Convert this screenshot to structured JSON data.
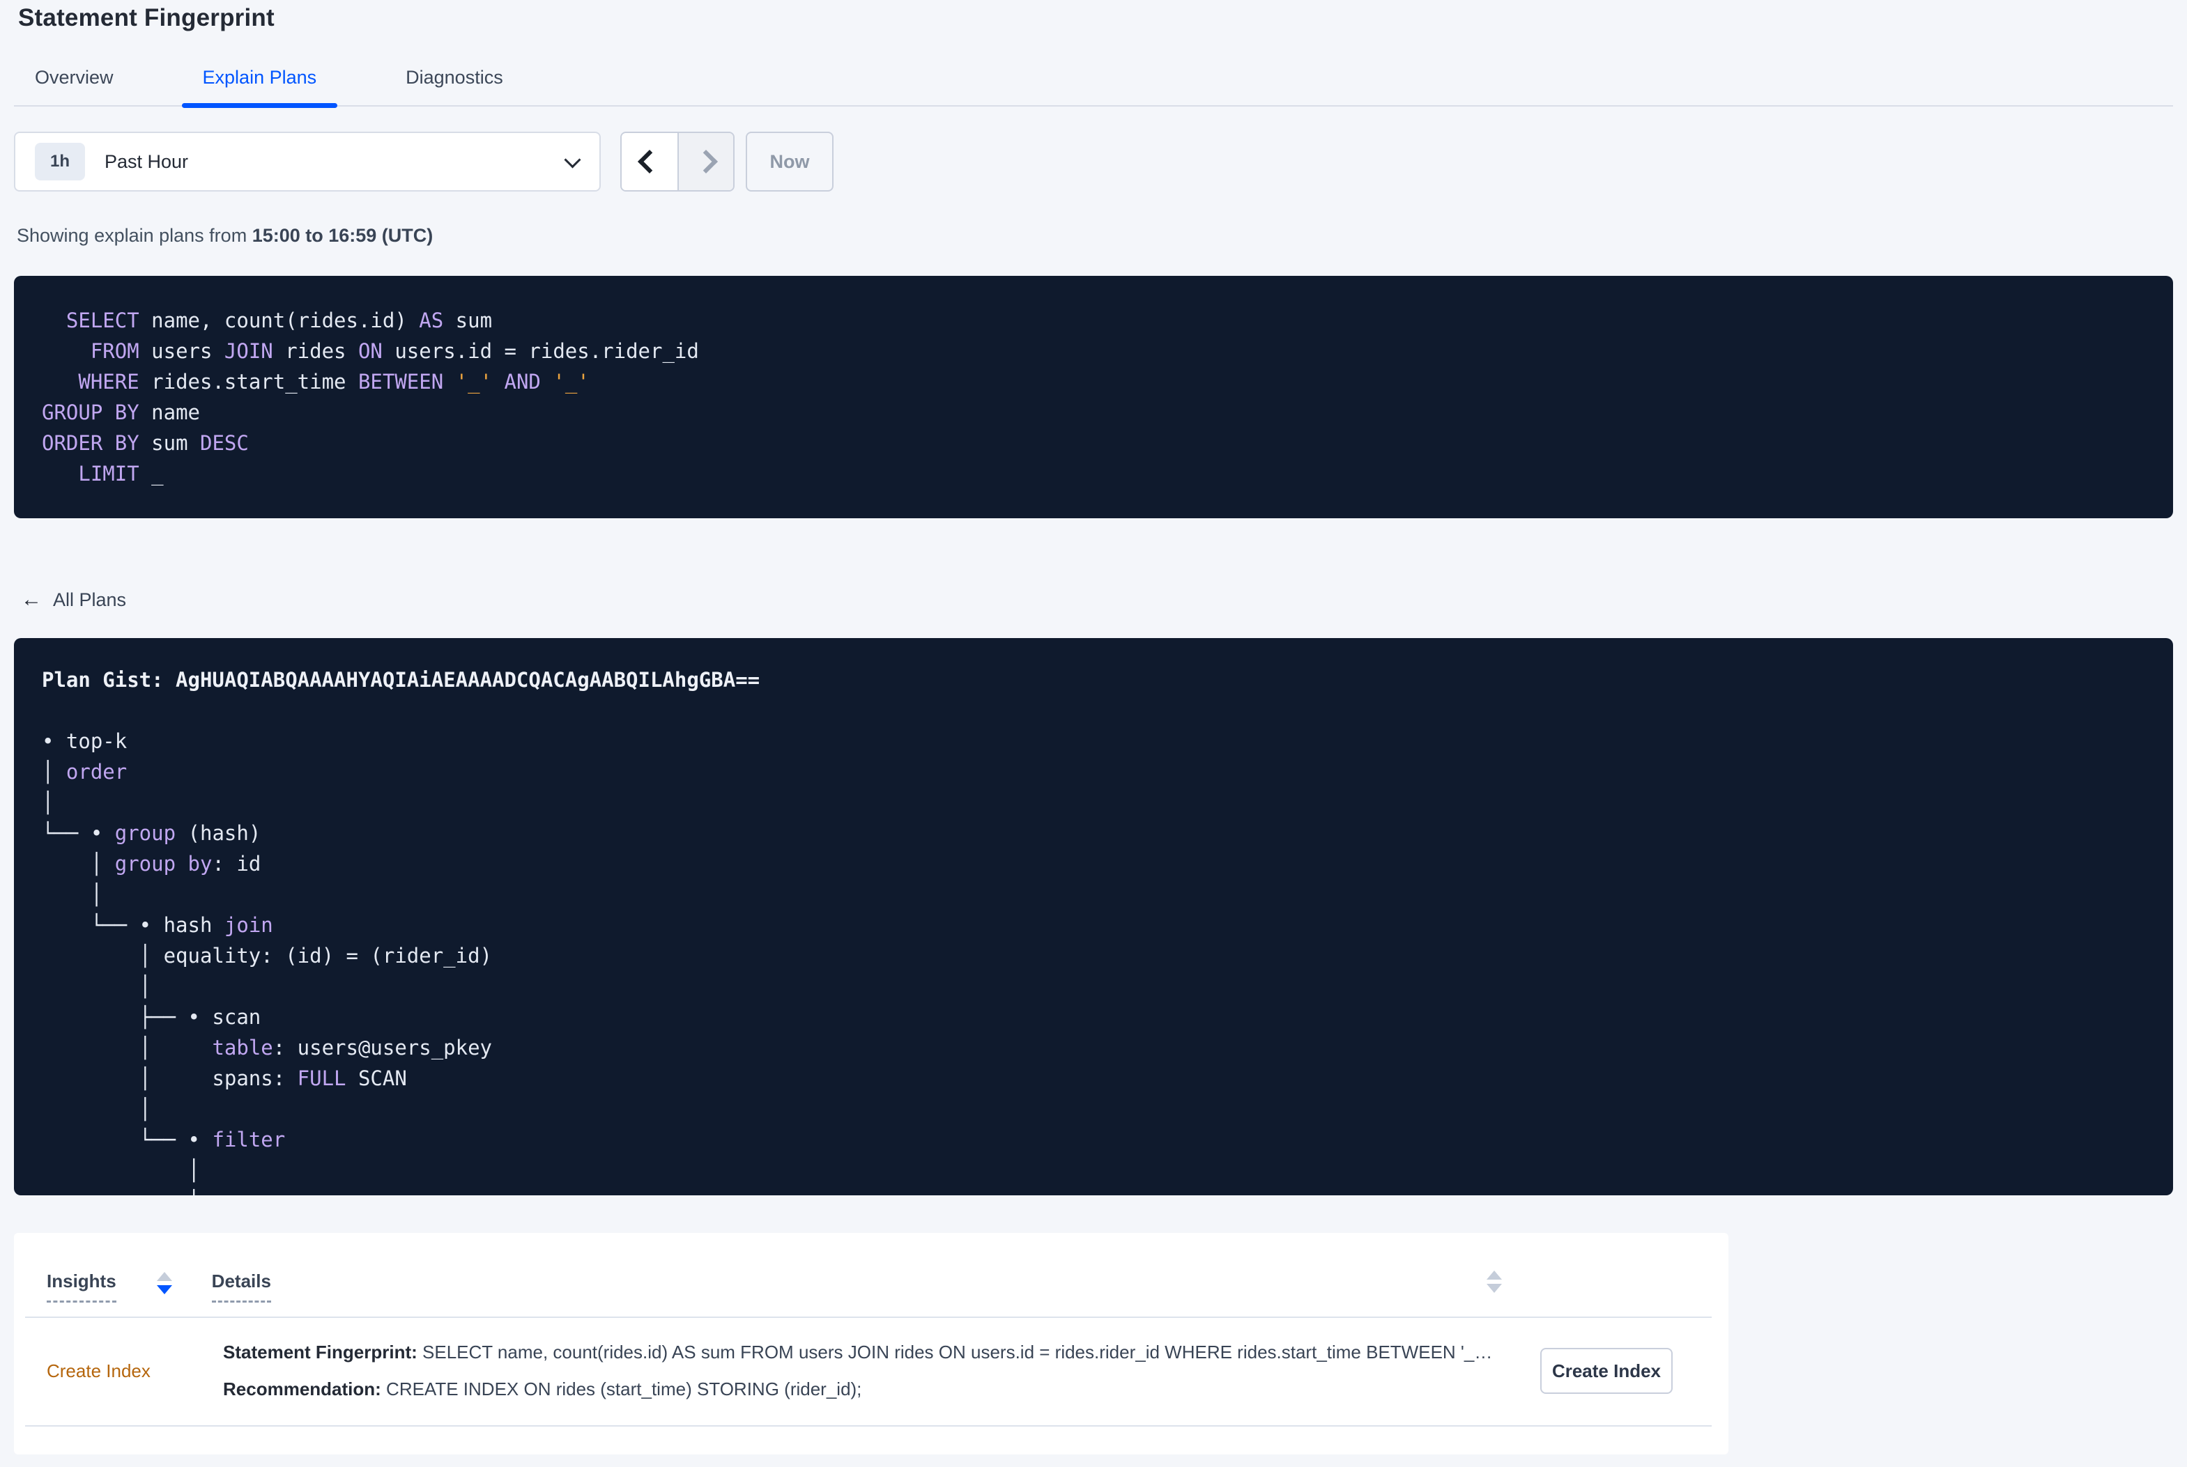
{
  "window": {
    "title": "Statement Fingerprint"
  },
  "tabs": [
    {
      "id": "overview",
      "label": "Overview",
      "active": false
    },
    {
      "id": "explain-plans",
      "label": "Explain Plans",
      "active": true
    },
    {
      "id": "diagnostics",
      "label": "Diagnostics",
      "active": false
    }
  ],
  "time_picker": {
    "badge": "1h",
    "selected": "Past Hour",
    "prev_enabled": true,
    "next_enabled": false,
    "now_label": "Now"
  },
  "subtitle": {
    "prefix": "Showing explain plans from ",
    "bold_range": "15:00 to 16:59 (UTC)"
  },
  "sql_box": {
    "lines": [
      [
        {
          "c": "k",
          "t": "  SELECT"
        },
        {
          "c": "p",
          "t": " name, count(rides.id) "
        },
        {
          "c": "k",
          "t": "AS"
        },
        {
          "c": "p",
          "t": " sum"
        }
      ],
      [
        {
          "c": "k",
          "t": "    FROM"
        },
        {
          "c": "p",
          "t": " users "
        },
        {
          "c": "k",
          "t": "JOIN"
        },
        {
          "c": "p",
          "t": " rides "
        },
        {
          "c": "k",
          "t": "ON"
        },
        {
          "c": "p",
          "t": " users.id = rides.rider_id"
        }
      ],
      [
        {
          "c": "k",
          "t": "   WHERE"
        },
        {
          "c": "p",
          "t": " rides.start_time "
        },
        {
          "c": "k",
          "t": "BETWEEN"
        },
        {
          "c": "p",
          "t": " "
        },
        {
          "c": "l",
          "t": "'_'"
        },
        {
          "c": "p",
          "t": " "
        },
        {
          "c": "k",
          "t": "AND"
        },
        {
          "c": "p",
          "t": " "
        },
        {
          "c": "l",
          "t": "'_'"
        }
      ],
      [
        {
          "c": "k",
          "t": "GROUP BY"
        },
        {
          "c": "p",
          "t": " name"
        }
      ],
      [
        {
          "c": "k",
          "t": "ORDER BY"
        },
        {
          "c": "p",
          "t": " sum "
        },
        {
          "c": "k",
          "t": "DESC"
        }
      ],
      [
        {
          "c": "k",
          "t": "   LIMIT"
        },
        {
          "c": "p",
          "t": " _"
        }
      ]
    ]
  },
  "all_plans": {
    "icon": "←",
    "label": "All Plans"
  },
  "plan_box": {
    "gist": "Plan Gist: AgHUAQIABQAAAAHYAQIAiAEAAAADCQACAgAABQILAhgGBA==",
    "lines": [
      [
        {
          "c": "b",
          "t": "Plan Gist: AgHUAQIABQAAAAHYAQIAiAEAAAADCQACAgAABQILAhgGBA=="
        }
      ],
      [],
      [
        {
          "c": "p",
          "t": "• top-k"
        }
      ],
      [
        {
          "c": "p",
          "t": "│ "
        },
        {
          "c": "k",
          "t": "order"
        }
      ],
      [
        {
          "c": "p",
          "t": "│"
        }
      ],
      [
        {
          "c": "p",
          "t": "└── • "
        },
        {
          "c": "k",
          "t": "group"
        },
        {
          "c": "p",
          "t": " (hash)"
        }
      ],
      [
        {
          "c": "p",
          "t": "    │ "
        },
        {
          "c": "k",
          "t": "group by"
        },
        {
          "c": "p",
          "t": ": id"
        }
      ],
      [
        {
          "c": "p",
          "t": "    │"
        }
      ],
      [
        {
          "c": "p",
          "t": "    └── • hash "
        },
        {
          "c": "k",
          "t": "join"
        }
      ],
      [
        {
          "c": "p",
          "t": "        │ equality: (id) = (rider_id)"
        }
      ],
      [
        {
          "c": "p",
          "t": "        │"
        }
      ],
      [
        {
          "c": "p",
          "t": "        ├── • scan"
        }
      ],
      [
        {
          "c": "p",
          "t": "        │     "
        },
        {
          "c": "k",
          "t": "table"
        },
        {
          "c": "p",
          "t": ": users@users_pkey"
        }
      ],
      [
        {
          "c": "p",
          "t": "        │     spans: "
        },
        {
          "c": "k",
          "t": "FULL"
        },
        {
          "c": "p",
          "t": " SCAN"
        }
      ],
      [
        {
          "c": "p",
          "t": "        │"
        }
      ],
      [
        {
          "c": "p",
          "t": "        └── • "
        },
        {
          "c": "k",
          "t": "filter"
        }
      ],
      [
        {
          "c": "p",
          "t": "            │"
        }
      ],
      [
        {
          "c": "p",
          "t": "            │"
        }
      ]
    ]
  },
  "insights_table": {
    "headers": [
      {
        "label": "Insights",
        "sort": "desc"
      },
      {
        "label": "Details",
        "sort": "none"
      }
    ],
    "rows": [
      {
        "insight": "Create Index",
        "statement_label": "Statement Fingerprint:",
        "statement": " SELECT name, count(rides.id) AS sum FROM users JOIN rides ON users.id = rides.rider_id WHERE rides.start_time BETWEEN '_…",
        "recommendation_label": "Recommendation:",
        "recommendation": " CREATE INDEX ON rides (start_time) STORING (rider_id);",
        "action_label": "Create Index"
      }
    ]
  },
  "colors": {
    "accent_blue": "#0055ff",
    "page_bg": "#f4f6fa",
    "code_bg": "#0f1a2d",
    "code_keyword": "#c1a7f1",
    "code_text": "#e4e9f2",
    "code_literal": "#eca43f",
    "insight_link_orange": "#b5660d",
    "text_dark": "#242a35",
    "text_muted_gray": "#8f99a8"
  }
}
